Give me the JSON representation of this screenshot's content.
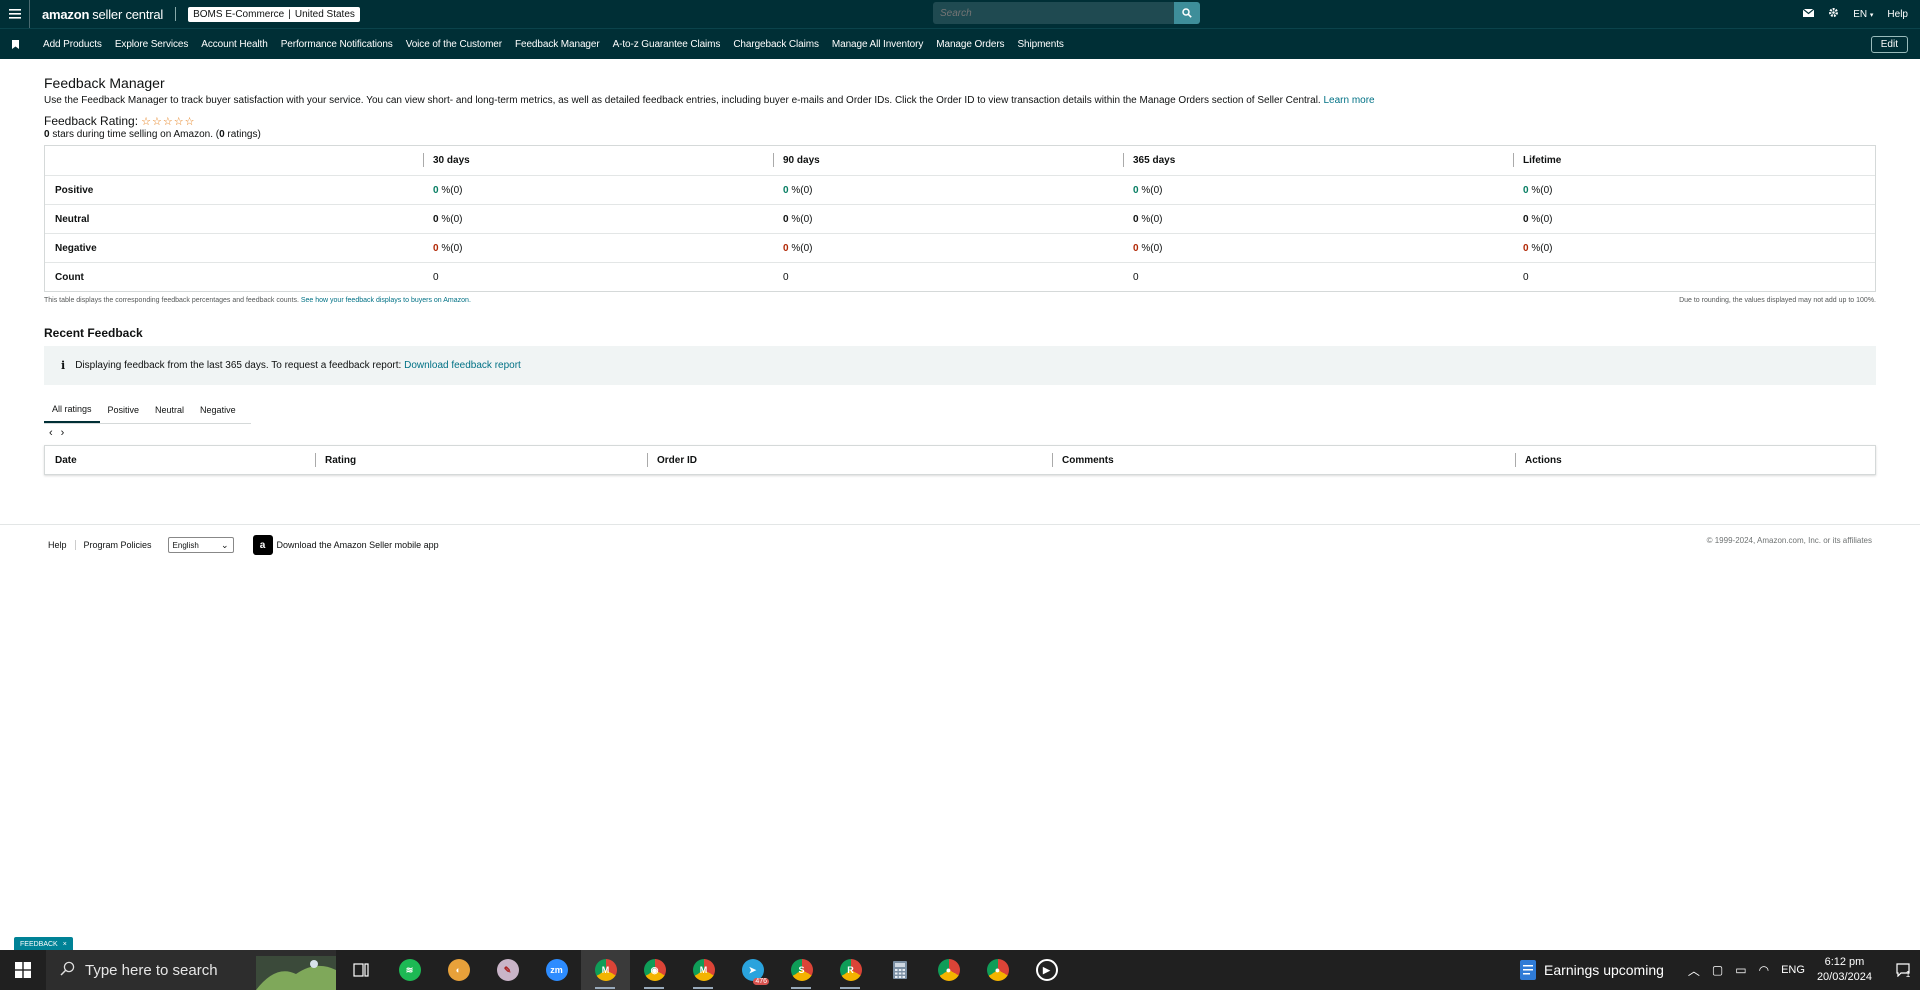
{
  "header": {
    "logo_main": "amazon",
    "logo_sub": "seller central",
    "store_name": "BOMS E-Commerce",
    "store_sep": "|",
    "store_region": "United States",
    "search_placeholder": "Search",
    "language": "EN",
    "help": "Help"
  },
  "nav": {
    "items": [
      "Add Products",
      "Explore Services",
      "Account Health",
      "Performance Notifications",
      "Voice of the Customer",
      "Feedback Manager",
      "A-to-z Guarantee Claims",
      "Chargeback Claims",
      "Manage All Inventory",
      "Manage Orders",
      "Shipments"
    ],
    "edit": "Edit"
  },
  "page": {
    "title": "Feedback Manager",
    "description": "Use the Feedback Manager to track buyer satisfaction with your service. You can view short- and long-term metrics, as well as detailed feedback entries, including buyer e-mails and Order IDs. Click the Order ID to view transaction details within the Manage Orders section of Seller Central.",
    "learn_more": "Learn more",
    "rating_label": "Feedback Rating:",
    "stars": 0,
    "rating_sub_stars": "0",
    "rating_sub_text1": " stars during time selling on Amazon. (",
    "rating_sub_count": "0",
    "rating_sub_text2": " ratings)"
  },
  "metrics": {
    "columns": [
      "30 days",
      "90 days",
      "365 days",
      "Lifetime"
    ],
    "rows": [
      {
        "label": "Positive",
        "cells": [
          [
            "0",
            " %(0)"
          ],
          [
            "0",
            " %(0)"
          ],
          [
            "0",
            " %(0)"
          ],
          [
            "0",
            " %(0)"
          ]
        ]
      },
      {
        "label": "Neutral",
        "cells": [
          [
            "0",
            " %(0)"
          ],
          [
            "0",
            " %(0)"
          ],
          [
            "0",
            " %(0)"
          ],
          [
            "0",
            " %(0)"
          ]
        ]
      },
      {
        "label": "Negative",
        "cells": [
          [
            "0",
            " %(0)"
          ],
          [
            "0",
            " %(0)"
          ],
          [
            "0",
            " %(0)"
          ],
          [
            "0",
            " %(0)"
          ]
        ]
      },
      {
        "label": "Count",
        "cells": [
          [
            "",
            "0"
          ],
          [
            "",
            "0"
          ],
          [
            "",
            "0"
          ],
          [
            "",
            "0"
          ]
        ]
      }
    ],
    "note_left": "This table displays the corresponding feedback percentages and feedback counts.",
    "note_link": "See how your feedback displays to buyers on Amazon.",
    "note_right": "Due to rounding, the values displayed may not add up to 100%."
  },
  "recent": {
    "title": "Recent Feedback",
    "info_icon": "i",
    "info_text": "Displaying feedback from the last 365 days. To request a feedback report:",
    "info_link": "Download feedback report",
    "tabs": [
      "All ratings",
      "Positive",
      "Neutral",
      "Negative"
    ],
    "active_tab": "All ratings",
    "prev": "‹",
    "next": "›",
    "columns": [
      "Date",
      "Rating",
      "Order ID",
      "Comments",
      "Actions"
    ]
  },
  "footer": {
    "help": "Help",
    "policies": "Program Policies",
    "language_selected": "English",
    "app_text": "Download the Amazon Seller mobile app",
    "copyright": "© 1999-2024, Amazon.com, Inc. or its affiliates"
  },
  "feedback_tag": {
    "label": "FEEDBACK",
    "close": "×"
  },
  "taskbar": {
    "search_placeholder": "Type here to search",
    "telegram_badge": "476",
    "earnings": "Earnings upcoming",
    "lang": "ENG",
    "time": "6:12 pm",
    "date": "20/03/2024",
    "notification_count": "1",
    "icons": [
      "windows-icon",
      "task-view-icon",
      "spotify-icon",
      "app-icon",
      "app-icon",
      "zoom-icon",
      "chrome-icon",
      "chrome-icon",
      "chrome-icon",
      "telegram-icon",
      "chrome-icon",
      "chrome-icon",
      "calculator-icon",
      "chrome-icon",
      "chrome-icon",
      "media-player-icon"
    ]
  },
  "colors": {
    "header_bg": "#002f36",
    "link": "#007185",
    "positive": "#067d62",
    "negative": "#b12704",
    "feedback_tag": "#008296"
  }
}
